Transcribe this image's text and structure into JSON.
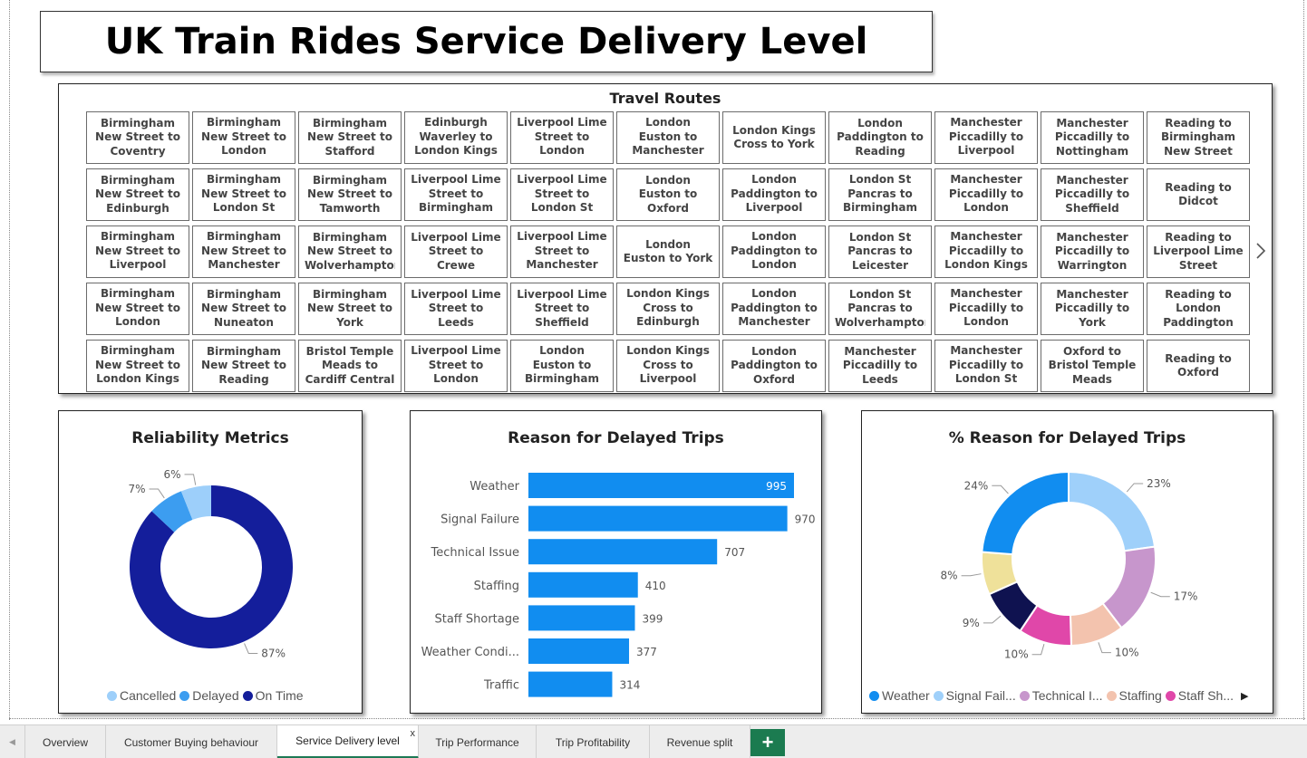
{
  "page_title": "UK Train Rides Service Delivery Level",
  "routes": {
    "title": "Travel Routes",
    "items": [
      "Birmingham New Street to Coventry",
      "Birmingham New Street to London Paddi...",
      "Birmingham New Street to Stafford",
      "Edinburgh Waverley to London Kings ...",
      "Liverpool Lime Street to London Paddington",
      "London Euston to Manchester Piccadilly",
      "London Kings Cross to York",
      "London Paddington to Reading",
      "Manchester Piccadilly to Liverpool Lime...",
      "Manchester Piccadilly to Nottingham",
      "Reading to Birmingham New Street",
      "Birmingham New Street to Edinburgh",
      "Birmingham New Street to London St Pan...",
      "Birmingham New Street to Tamworth",
      "Liverpool Lime Street to Birmingham N...",
      "Liverpool Lime Street to London St Pancras",
      "London Euston to Oxford",
      "London Paddington to Liverpool Lime...",
      "London St Pancras to Birmingham N...",
      "Manchester Piccadilly to London Euston",
      "Manchester Piccadilly to Sheffield",
      "Reading to Didcot",
      "Birmingham New Street to Liverpool Lime...",
      "Birmingham New Street to Manchester Pi...",
      "Birmingham New Street to Wolverhampton",
      "Liverpool Lime Street to Crewe",
      "Liverpool Lime Street to Manchester Pi...",
      "London Euston to York",
      "London Paddington to London Waterl...",
      "London St Pancras to Leicester",
      "Manchester Piccadilly to London Kings ...",
      "Manchester Piccadilly to Warrington",
      "Reading to Liverpool Lime Street",
      "Birmingham New Street to London Euston",
      "Birmingham New Street to Nuneaton",
      "Birmingham New Street to York",
      "Liverpool Lime Street to Leeds",
      "Liverpool Lime Street to Sheffield",
      "London Kings Cross to Edinburgh Wa...",
      "London Paddington to Manchester Pi...",
      "London St Pancras to Wolverhampton",
      "Manchester Piccadilly to London Paddi...",
      "Manchester Piccadilly to York",
      "Reading to London Paddington",
      "Birmingham New Street to London Kings ...",
      "Birmingham New Street to Reading",
      "Bristol Temple Meads to Cardiff Central",
      "Liverpool Lime Street to London Euston",
      "London Euston to Birmingham New Street",
      "London Kings Cross to Liverpool Lime...",
      "London Paddington to Oxford",
      "Manchester Piccadilly to Leeds",
      "Manchester Piccadilly to London St Pan...",
      "Oxford to Bristol Temple Meads",
      "Reading to Oxford"
    ],
    "next_icon": "chevron-right-icon"
  },
  "reliability": {
    "title": "Reliability Metrics",
    "legend": [
      {
        "label": "Cancelled",
        "color": "#9dcffa"
      },
      {
        "label": "Delayed",
        "color": "#3c9df0"
      },
      {
        "label": "On Time",
        "color": "#141e9b"
      }
    ],
    "labels": [
      "87%",
      "7%",
      "6%"
    ]
  },
  "reasons_bar": {
    "title": "Reason for Delayed Trips",
    "color": "#118df0"
  },
  "reasons_donut": {
    "title": "% Reason for Delayed Trips",
    "legend": [
      {
        "label": "Weather",
        "color": "#118df0"
      },
      {
        "label": "Signal Fail...",
        "color": "#9fd0fa"
      },
      {
        "label": "Technical I...",
        "color": "#c796cc"
      },
      {
        "label": "Staffing",
        "color": "#f3c3ae"
      },
      {
        "label": "Staff Sh...",
        "color": "#e047a9"
      }
    ],
    "more_icon": "caret-right-icon"
  },
  "chart_data": [
    {
      "type": "pie",
      "title": "Reliability Metrics",
      "categories": [
        "On Time",
        "Delayed",
        "Cancelled"
      ],
      "values": [
        87,
        7,
        6
      ],
      "unit": "%",
      "colors": [
        "#141e9b",
        "#3c9df0",
        "#9dcffa"
      ],
      "legend_position": "bottom"
    },
    {
      "type": "bar",
      "orientation": "horizontal",
      "title": "Reason for Delayed Trips",
      "categories": [
        "Weather",
        "Signal Failure",
        "Technical Issue",
        "Staffing",
        "Staff Shortage",
        "Weather Condi...",
        "Traffic"
      ],
      "values": [
        995,
        970,
        707,
        410,
        399,
        377,
        314
      ],
      "color": "#118df0"
    },
    {
      "type": "pie",
      "title": "% Reason for Delayed Trips",
      "categories": [
        "Signal Failure",
        "Technical Issue",
        "Staffing",
        "Staff Shortage",
        "Traffic",
        "Weather Conditions",
        "Weather"
      ],
      "values": [
        23,
        17,
        10,
        10,
        9,
        8,
        24
      ],
      "unit": "%",
      "colors": [
        "#9fd0fa",
        "#c796cc",
        "#f3c3ae",
        "#e047a9",
        "#0f1250",
        "#efe19a",
        "#118df0"
      ],
      "legend_position": "bottom"
    }
  ],
  "tabs": {
    "items": [
      {
        "label": "Overview"
      },
      {
        "label": "Customer Buying behaviour"
      },
      {
        "label": "Service Delivery level",
        "active": true
      },
      {
        "label": "Trip Performance"
      },
      {
        "label": "Trip Profitability"
      },
      {
        "label": "Revenue split"
      }
    ],
    "close_label": "x",
    "add_label": "+"
  }
}
